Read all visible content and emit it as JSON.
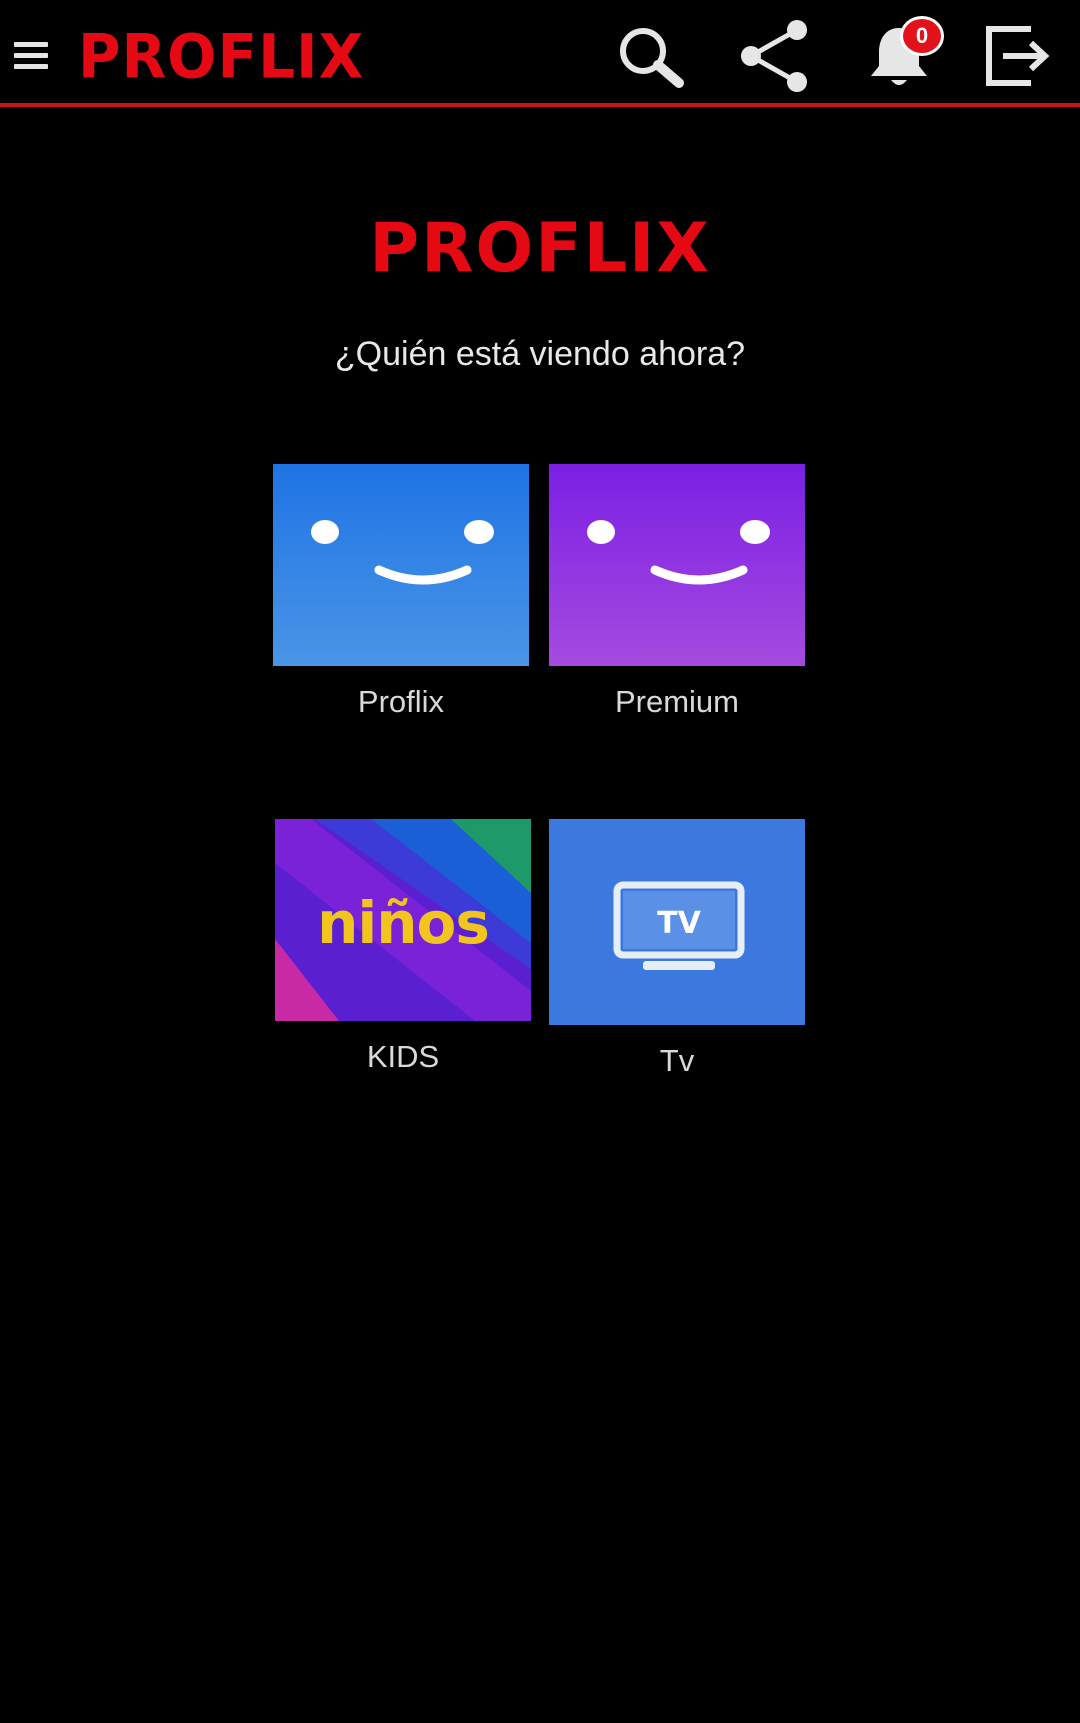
{
  "app": {
    "brand": "PROFLIX",
    "accent_color": "#e50914"
  },
  "topbar": {
    "menu_icon": "hamburger-menu-icon",
    "actions": [
      {
        "icon": "search-icon"
      },
      {
        "icon": "share-icon"
      },
      {
        "icon": "bell-icon",
        "badge": "0"
      },
      {
        "icon": "exit-icon"
      }
    ]
  },
  "profiles_screen": {
    "brand": "PROFLIX",
    "prompt": "¿Quién está viendo ahora?",
    "profiles": [
      {
        "label": "Proflix",
        "avatar": "smiley-face-icon",
        "color": "#1f74e4"
      },
      {
        "label": "Premium",
        "avatar": "smiley-face-icon",
        "color": "#8a2be2"
      },
      {
        "label": "KIDS",
        "avatar_text": "niños"
      },
      {
        "label": "Tv",
        "avatar": "tv-icon",
        "avatar_text": "TV",
        "color": "#3c79df"
      }
    ]
  }
}
